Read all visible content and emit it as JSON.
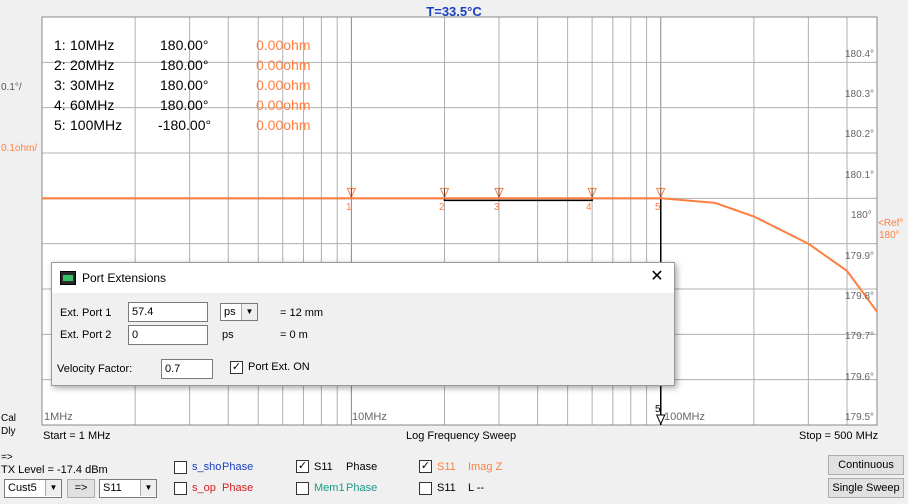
{
  "header": {
    "temperature": "T=33.5°C"
  },
  "left_labels": {
    "scale_phase": "0.1°/",
    "scale_imag": "0.1ohm/",
    "cal": "Cal",
    "dly": "Dly"
  },
  "markers_table": [
    {
      "id": "1:",
      "freq": "10MHz",
      "phase": "180.00°",
      "value": "0.00ohm"
    },
    {
      "id": "2:",
      "freq": "20MHz",
      "phase": "180.00°",
      "value": "0.00ohm"
    },
    {
      "id": "3:",
      "freq": "30MHz",
      "phase": "180.00°",
      "value": "0.00ohm"
    },
    {
      "id": "4:",
      "freq": "60MHz",
      "phase": "180.00°",
      "value": "0.00ohm"
    },
    {
      "id": "5:",
      "freq": "100MHz",
      "phase": "-180.00°",
      "value": "0.00ohm"
    }
  ],
  "right_ticks": [
    "180.4°",
    "180.3°",
    "180.2°",
    "180.1°",
    "180°",
    "179.9°",
    "179.8°",
    "179.7°",
    "179.6°",
    "179.5°"
  ],
  "ref_label": "<Ref°",
  "ref_label2": "180°",
  "marker_labels": [
    "1",
    "2",
    "3",
    "4",
    "5"
  ],
  "x_ticks": {
    "t1": "1MHz",
    "t2": "10MHz",
    "t3": "100MHz"
  },
  "sweep": {
    "start": "Start = 1 MHz",
    "mode": "Log Frequency Sweep",
    "stop": "Stop = 500 MHz"
  },
  "dialog": {
    "title": "Port Extensions",
    "close": "✕",
    "port1_label": "Ext. Port 1",
    "port1_value": "57.4",
    "port1_unit": "ps",
    "port1_result": "= 12 mm",
    "port2_label": "Ext. Port 2",
    "port2_value": "0",
    "port2_unit": "ps",
    "port2_result": "= 0 m",
    "vf_label": "Velocity Factor:",
    "vf_value": "0.7",
    "portext_label": "Port Ext. ON"
  },
  "bottom": {
    "arrow": "=>",
    "tx_level": "TX Level = -17.4 dBm",
    "cust_select": "Cust5",
    "arrow_button": "=>",
    "param_select": "S11",
    "traces": {
      "s_sho_a": "s_sho",
      "s_sho_b": "Phase",
      "s_op_a": "s_op",
      "s_op_b": "Phase",
      "s11_phase_a": "S11",
      "s11_phase_b": "Phase",
      "mem1_a": "Mem1",
      "mem1_b": "Phase",
      "s11_imag_a": "S11",
      "s11_imag_b": "Imag Z",
      "s11_l_a": "S11",
      "s11_l_b": "L --"
    },
    "continuous": "Continuous",
    "single_sweep": "Single Sweep"
  },
  "colors": {
    "orange": "#ff7f3f",
    "blue": "#1a3fc0",
    "red": "#d02020",
    "teal": "#1a9a8a"
  },
  "chart_data": {
    "type": "line",
    "x_scale": "log",
    "x_range_mhz": [
      1,
      500
    ],
    "y_range_deg": [
      179.5,
      180.4
    ],
    "markers_mhz": [
      10,
      20,
      30,
      60,
      100
    ],
    "series": [
      {
        "x": [
          1,
          30,
          100,
          150,
          200,
          300,
          400,
          500
        ],
        "y": [
          180,
          180,
          180,
          179.99,
          179.96,
          179.9,
          179.84,
          179.75
        ]
      }
    ]
  }
}
